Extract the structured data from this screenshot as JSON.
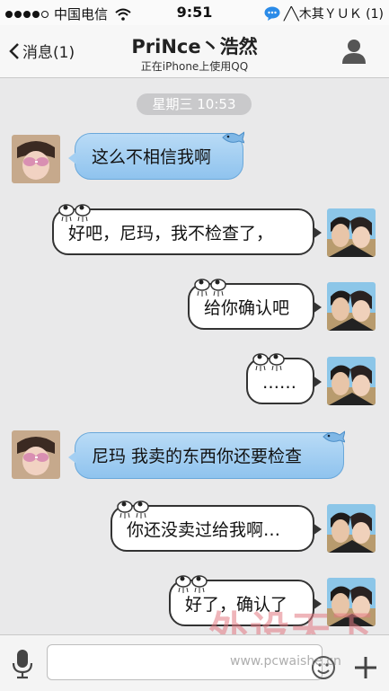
{
  "status_bar": {
    "carrier": "中国电信",
    "time": "9:51",
    "notification": "╱╲木其ＹＵＫ (1)"
  },
  "nav": {
    "back_label": "消息(1)",
    "title": "PriNce丶浩然",
    "subtitle": "正在iPhone上使用QQ"
  },
  "chat": {
    "timestamp": "星期三 10:53",
    "messages": [
      {
        "side": "in",
        "text": "这么不相信我啊"
      },
      {
        "side": "out",
        "text": "好吧，尼玛，我不检查了，"
      },
      {
        "side": "out",
        "text": "给你确认吧"
      },
      {
        "side": "out",
        "text": "……"
      },
      {
        "side": "in",
        "text": "尼玛 我卖的东西你还要检查"
      },
      {
        "side": "out",
        "text": "你还没卖过给我啊…"
      },
      {
        "side": "out",
        "text": "好了，确认了"
      }
    ]
  },
  "input": {
    "placeholder": ""
  },
  "watermark": {
    "main": "外设天下",
    "url": "www.pcwaishe.cn"
  },
  "colors": {
    "incoming_bubble": "#a4cff2",
    "outgoing_bubble": "#ffffff",
    "timestamp_pill": "#c9c9cb",
    "background": "#e9e9ea"
  },
  "icons": [
    "signal-dots-icon",
    "wifi-icon",
    "qq-bubble-icon",
    "back-chevron-icon",
    "profile-icon",
    "microphone-icon",
    "emoji-icon",
    "plus-icon"
  ]
}
